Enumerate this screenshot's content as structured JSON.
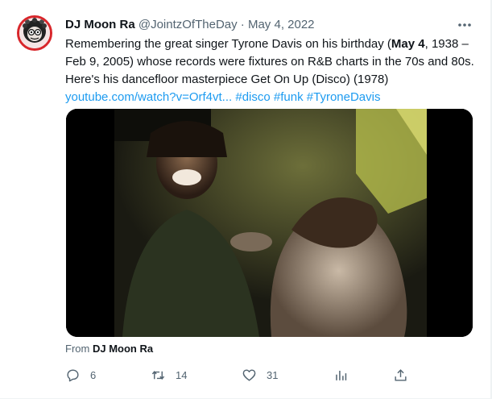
{
  "tweet": {
    "author_name": "DJ Moon Ra",
    "handle": "@JointzOfTheDay",
    "separator": "·",
    "date": "May 4, 2022",
    "text_parts": {
      "p1": "Remembering the great singer Tyrone Davis on his birthday (",
      "bold": "May 4",
      "p2": ", 1938 – Feb 9, 2005) whose records were fixtures on R&B charts in the 70s and 80s. Here's his dancefloor masterpiece Get On Up (Disco) (1978) "
    },
    "link_url": "youtube.com/watch?v=Orf4vt...",
    "hashtags": [
      "#disco",
      "#funk",
      "#TyroneDavis"
    ],
    "from_prefix": "From",
    "from_name": "DJ Moon Ra"
  },
  "actions": {
    "replies": "6",
    "retweets": "14",
    "likes": "31"
  },
  "icons": {
    "more": "more-horizontal-icon",
    "reply": "reply-icon",
    "retweet": "retweet-icon",
    "like": "heart-icon",
    "views": "analytics-icon",
    "share": "share-icon"
  },
  "colors": {
    "link": "#1d9bf0",
    "text": "#0f1419",
    "muted": "#536471",
    "avatar_ring": "#d8262b"
  }
}
